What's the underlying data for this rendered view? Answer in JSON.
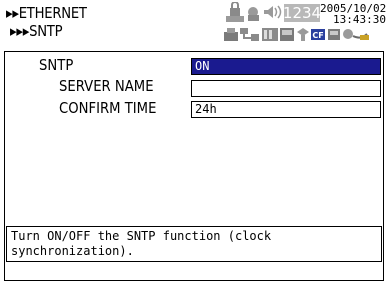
{
  "header": {
    "breadcrumb_level1": "▸▸ETHERNET",
    "breadcrumb_level2": "▸▸▸SNTP",
    "counter": "1234",
    "date": "2005/10/02",
    "time": "13:43:30",
    "status_icons": [
      "lock-icon",
      "key-icon",
      "speaker-icon",
      "network-icon",
      "printer-icon",
      "usb-icon",
      "cf-card-icon",
      "sd-card-icon",
      "paper-roll-icon"
    ]
  },
  "form": {
    "section_label": "SNTP",
    "sntp_value": "ON",
    "server_name_label": "SERVER NAME",
    "server_name_value": "",
    "confirm_time_label": "CONFIRM TIME",
    "confirm_time_value": "24h"
  },
  "help": {
    "text": "Turn ON/OFF the SNTP function (clock synchronization)."
  },
  "colors": {
    "selection": "#1a1a8f",
    "counter_fill": "#b8b8b8",
    "cf_badge": "#2a3f9e"
  }
}
